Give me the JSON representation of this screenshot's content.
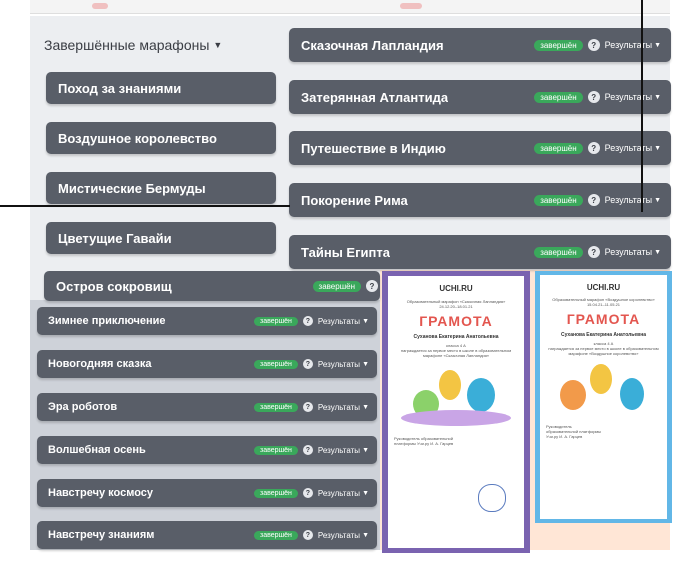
{
  "section": {
    "title": "Завершённые марафоны"
  },
  "labels": {
    "status": "завершён",
    "results": "Результаты",
    "help": "?"
  },
  "left_column": [
    "Поход за знаниями",
    "Воздушное королевство",
    "Мистические Бермуды",
    "Цветущие Гавайи"
  ],
  "ostrov": "Остров сокровищ",
  "right_column": [
    "Сказочная Лапландия",
    "Затерянная Атлантида",
    "Путешествие в Индию",
    "Покорение Рима",
    "Тайны Египта"
  ],
  "bottom_list": [
    "Зимнее приключение",
    "Новогодняя сказка",
    "Эра роботов",
    "Волшебная осень",
    "Навстречу космосу",
    "Навстречу знаниям"
  ],
  "certificates": [
    {
      "logo": "UCHI.RU",
      "marathon": "Образовательный марафон «Сказочная Лапландия»",
      "dates": "24.12.20–18.01.21",
      "title": "ГРАМОТА",
      "name": "Суханова Екатерина Анатольевна",
      "class": "класса 4 А",
      "award": "награждается за первое место в школе в образовательном марафоне «Сказочная Лапландия»",
      "signature": "Руководитель образовательной платформы Учи.ру И. А. Гарцев"
    },
    {
      "logo": "UCHI.RU",
      "marathon": "Образовательный марафон «Воздушное королевство»",
      "dates": "15.04.21–11.05.21",
      "title": "ГРАМОТА",
      "name": "Суханова Екатерина Анатольевна",
      "class": "класса 4 А",
      "award": "награждается за первое место в школе в образовательном марафоне «Воздушное королевство»",
      "signature": "Руководитель образовательной платформы Учи.ру И. А. Гарцев"
    }
  ],
  "colors": {
    "card": "#595e68",
    "badge": "#3aa85b",
    "gramota": "#e3564f",
    "frame1": "#7a63b0",
    "frame2": "#62b7e7"
  }
}
